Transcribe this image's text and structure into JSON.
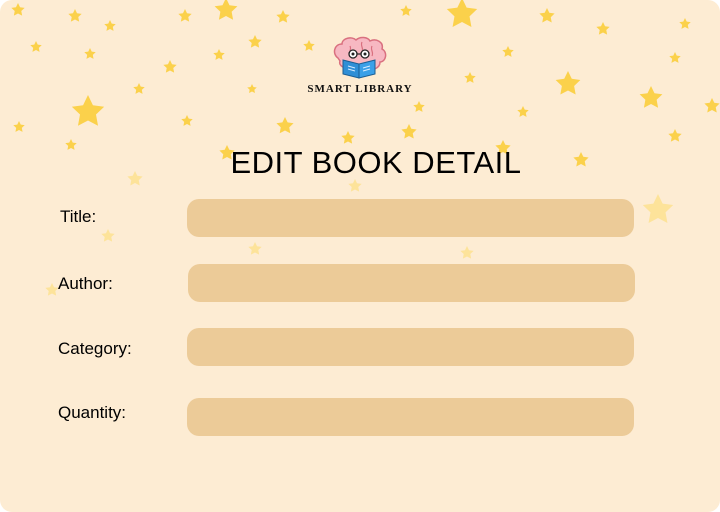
{
  "logo": {
    "text": "SMART LIBRARY",
    "icon": "brain-reading-book-icon"
  },
  "page_title": "EDIT BOOK DETAIL",
  "fields": [
    {
      "label": "Title:",
      "value": ""
    },
    {
      "label": "Author:",
      "value": ""
    },
    {
      "label": "Category:",
      "value": ""
    },
    {
      "label": "Quantity:",
      "value": ""
    }
  ],
  "colors": {
    "background": "#fdecd3",
    "input_fill": "#eccb98",
    "star": "#fbd14b"
  }
}
